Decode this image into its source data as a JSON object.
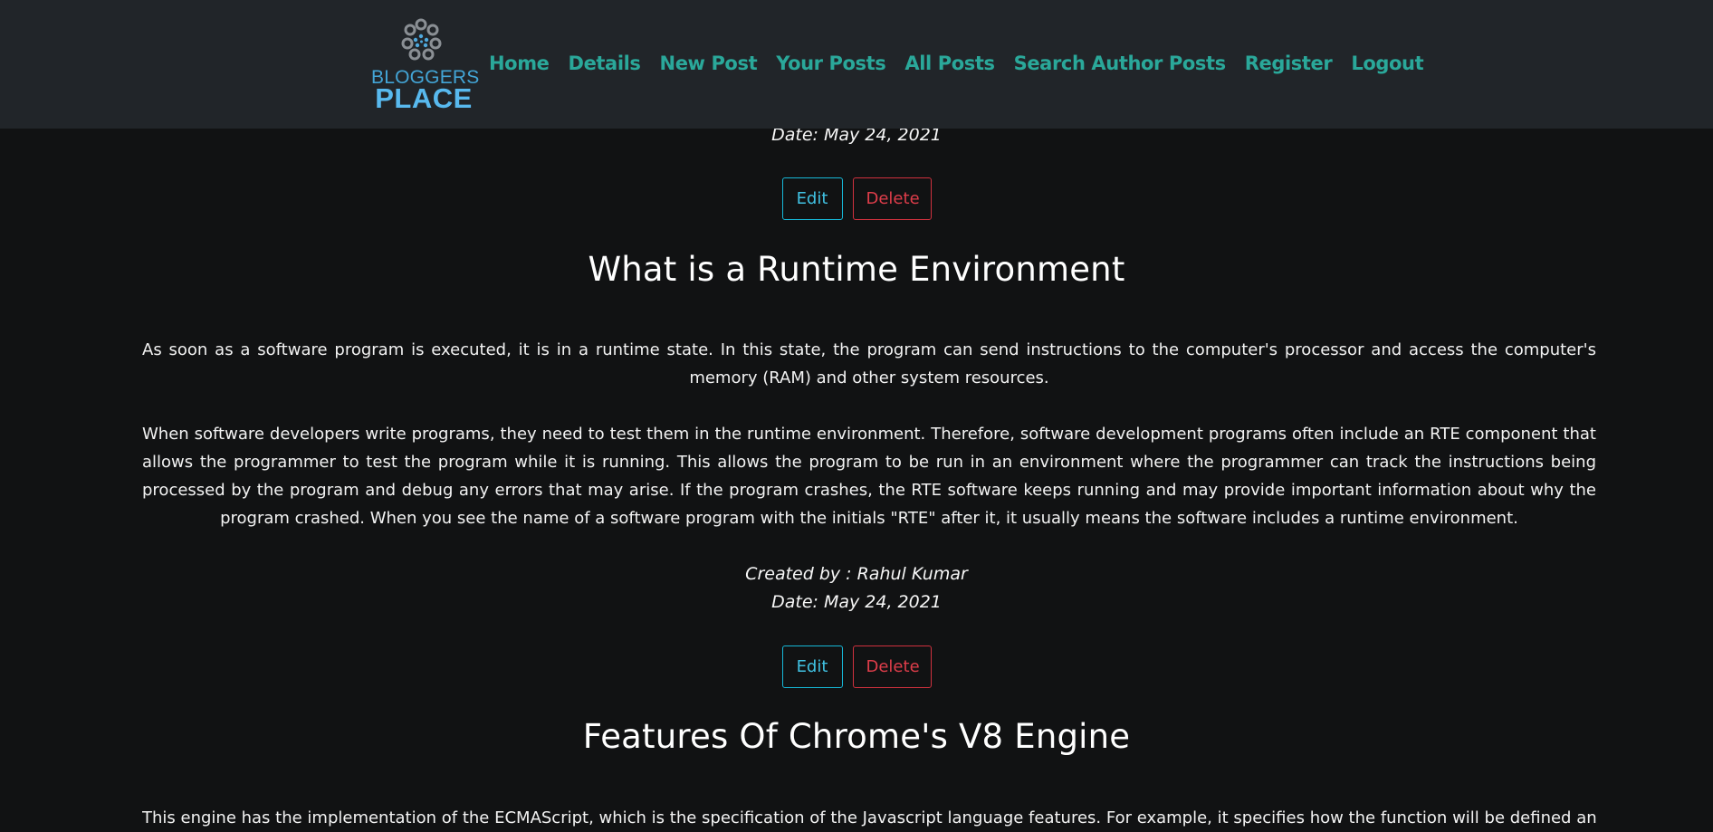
{
  "brand": {
    "line1": "BLOGGERS",
    "line2": "PLACE",
    "icon": "dots-circle-logo",
    "color": "#4fb1e6"
  },
  "nav": {
    "links": [
      "Home",
      "Details",
      "New Post",
      "Your Posts",
      "All Posts",
      "Search Author Posts",
      "Register",
      "Logout"
    ]
  },
  "top_meta": {
    "date": "Date: May 24, 2021"
  },
  "buttons": {
    "edit": "Edit",
    "delete": "Delete"
  },
  "posts": [
    {
      "title": "What is a Runtime Environment",
      "paragraphs": [
        "As soon as a software program is executed, it is in a runtime state. In this state, the program can send instructions to the computer's processor and access the computer's memory (RAM) and other system resources.",
        "When software developers write programs, they need to test them in the runtime environment. Therefore, software development programs often include an RTE component that allows the programmer to test the program while it is running. This allows the program to be run in an environment where the programmer can track the instructions being processed by the program and debug any errors that may arise. If the program crashes, the RTE software keeps running and may provide important information about why the program crashed. When you see the name of a software program with the initials \"RTE\" after it, it usually means the software includes a runtime environment."
      ],
      "created_by": "Created by : Rahul Kumar",
      "date": "Date: May 24, 2021"
    },
    {
      "title": "Features Of Chrome's V8 Engine",
      "paragraphs": [
        "This engine has the implementation of the ECMAScript, which is the specification of the Javascript language features. For example, it specifies how the function will be defined and how"
      ]
    }
  ],
  "colors": {
    "nav_bg": "#212529",
    "page_bg": "#111213",
    "nav_link": "#2aa89a",
    "edit": "#16b8d8",
    "delete": "#d0313e"
  }
}
